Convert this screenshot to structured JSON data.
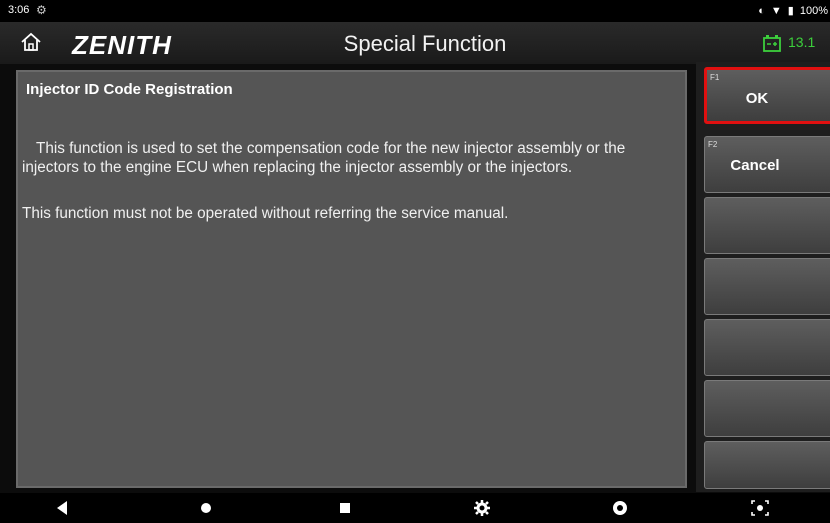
{
  "status": {
    "time": "3:06",
    "battery_pct": "100%"
  },
  "header": {
    "brand": "ZENITH",
    "title": "Special Function",
    "voltage": "13.1"
  },
  "content": {
    "heading": "Injector ID Code Registration",
    "paragraph1": "This function is used to set the compensation code for the new injector assembly or the injectors to the engine ECU when replacing the injector assembly or the injectors.",
    "paragraph2": "This function must not be operated without referring the service manual."
  },
  "side_buttons": [
    {
      "fkey": "F1",
      "label": "OK",
      "selected": true
    },
    {
      "fkey": "F2",
      "label": "Cancel",
      "selected": false
    },
    {
      "fkey": "",
      "label": ""
    },
    {
      "fkey": "",
      "label": ""
    },
    {
      "fkey": "",
      "label": ""
    },
    {
      "fkey": "",
      "label": ""
    },
    {
      "fkey": "",
      "label": ""
    }
  ],
  "nav_icons": [
    "back-icon",
    "home-icon",
    "recents-icon",
    "settings-icon",
    "chrome-icon",
    "screenshot-icon"
  ],
  "colors": {
    "accent_green": "#3ccf3c",
    "selected_border": "#e01010"
  }
}
